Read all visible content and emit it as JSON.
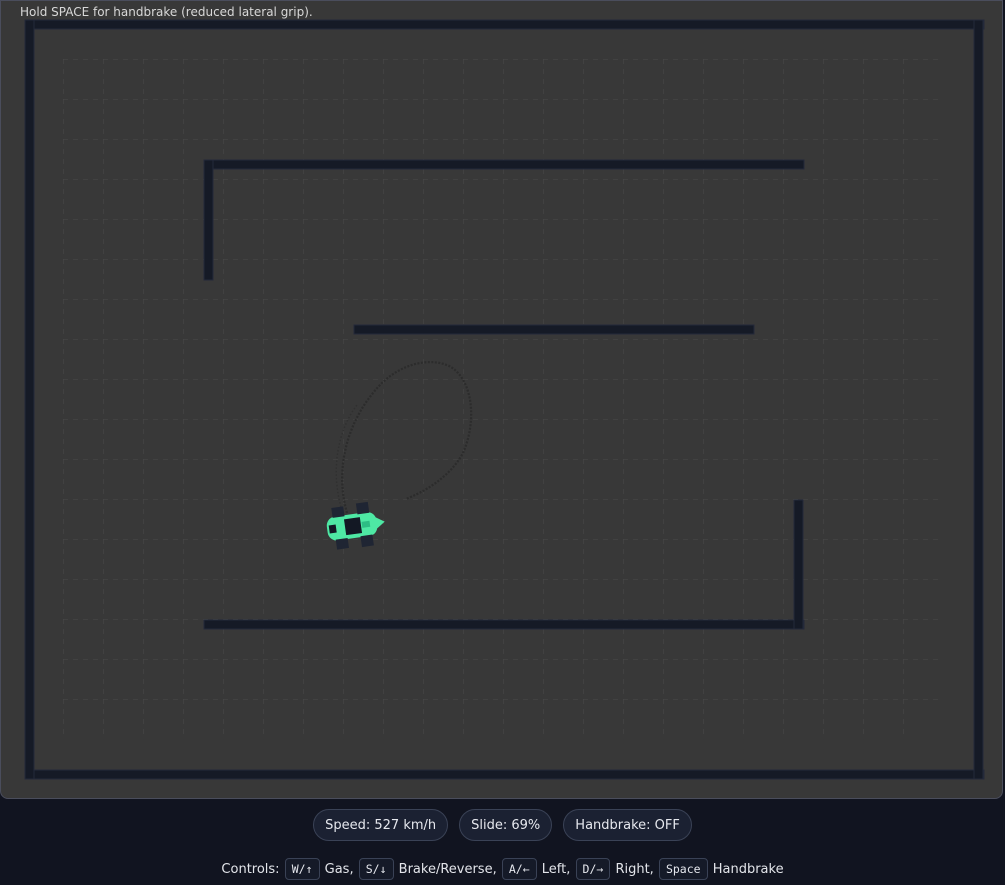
{
  "game": {
    "hint": "Hold SPACE for handbrake (reduced lateral grip).",
    "car_color": "#4ee8a4",
    "track_color": "#383838",
    "wall_color": "#151a26"
  },
  "hud": {
    "speed": "Speed: 527 km/h",
    "slide": "Slide: 69%",
    "handbrake": "Handbrake: OFF"
  },
  "controls": {
    "prefix": "Controls:",
    "items": [
      {
        "key": "W/↑",
        "action": "Gas,"
      },
      {
        "key": "S/↓",
        "action": "Brake/Reverse,"
      },
      {
        "key": "A/←",
        "action": "Left,"
      },
      {
        "key": "D/→",
        "action": "Right,"
      },
      {
        "key": "Space",
        "action": "Handbrake"
      }
    ]
  }
}
